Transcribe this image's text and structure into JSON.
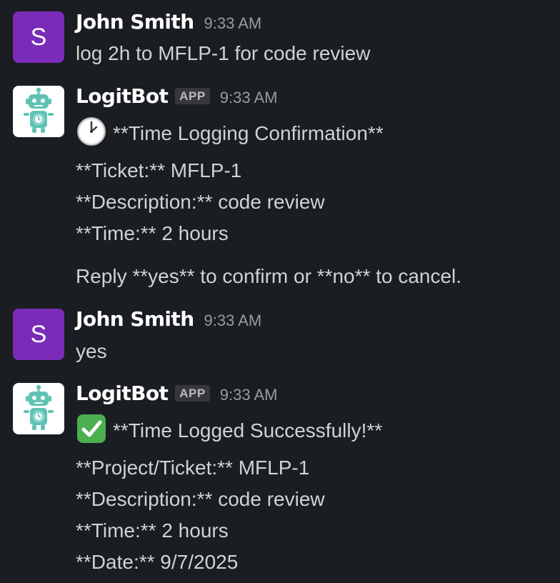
{
  "messages": [
    {
      "author": "John Smith",
      "avatar_letter": "S",
      "time": "9:33 AM",
      "text": "log 2h to MFLP-1 for code review"
    },
    {
      "author": "LogitBot",
      "badge": "APP",
      "time": "9:33 AM",
      "icon": "clock-icon",
      "lines": [
        "**Time Logging Confirmation**",
        "**Ticket:** MFLP-1",
        "**Description:** code review",
        "**Time:** 2 hours",
        "Reply **yes** to confirm or **no** to cancel."
      ]
    },
    {
      "author": "John Smith",
      "avatar_letter": "S",
      "time": "9:33 AM",
      "text": "yes"
    },
    {
      "author": "LogitBot",
      "badge": "APP",
      "time": "9:33 AM",
      "icon": "check-icon",
      "lines": [
        "**Time Logged Successfully!**",
        "**Project/Ticket:** MFLP-1",
        "**Description:** code review",
        "**Time:** 2 hours",
        "**Date:** 9/7/2025"
      ]
    }
  ],
  "colors": {
    "background": "#1a1d21",
    "user_avatar": "#7a2bb8",
    "bot_avatar_bg": "#ffffff",
    "bot_robot": "#5fc3b4",
    "text": "#d1d2d3",
    "name": "#ffffff",
    "timestamp": "#9a9b9e",
    "check_green": "#4caf50"
  }
}
